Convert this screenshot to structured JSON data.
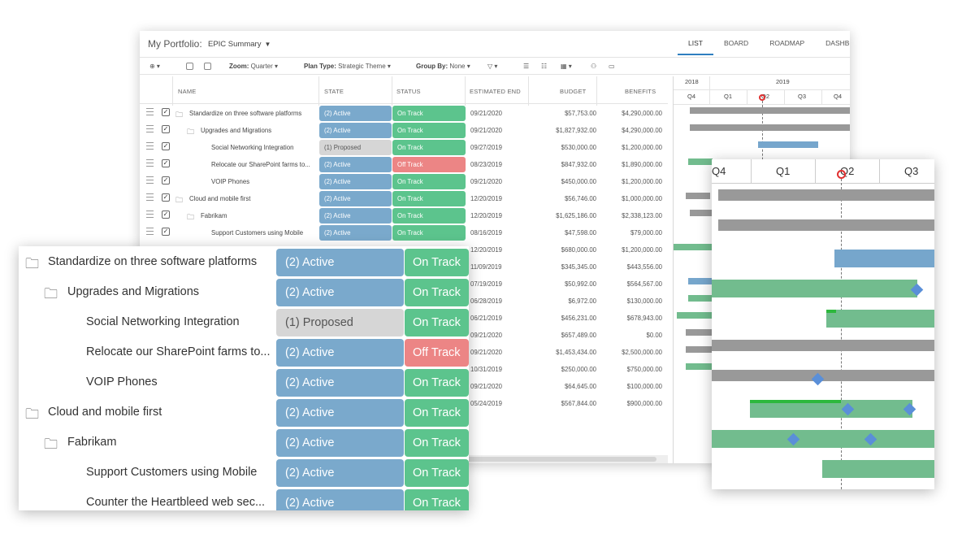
{
  "window": {
    "title": "My Portfolio:",
    "view_name": "EPIC Summary",
    "view_tabs": [
      "LIST",
      "BOARD",
      "ROADMAP",
      "DASHBO"
    ]
  },
  "toolbar": {
    "zoom_label": "Zoom:",
    "zoom_value": "Quarter",
    "plan_type_label": "Plan Type:",
    "plan_type_value": "Strategic Theme",
    "group_by_label": "Group By:",
    "group_by_value": "None"
  },
  "columns": {
    "name": "NAME",
    "state": "STATE",
    "status": "STATUS",
    "estimated_end": "ESTIMATED END",
    "budget": "BUDGET",
    "benefits": "BENEFITS"
  },
  "rows": [
    {
      "name": "Standardize on three software platforms",
      "state": "(2) Active",
      "status": "On Track",
      "end": "09/21/2020",
      "budget": "$57,753.00",
      "benefits": "$4,290,000.00"
    },
    {
      "name": "Upgrades and Migrations",
      "state": "(2) Active",
      "status": "On Track",
      "end": "09/21/2020",
      "budget": "$1,827,932.00",
      "benefits": "$4,290,000.00"
    },
    {
      "name": "Social Networking Integration",
      "state": "(1) Proposed",
      "status": "On Track",
      "end": "09/27/2019",
      "budget": "$530,000.00",
      "benefits": "$1,200,000.00"
    },
    {
      "name": "Relocate our SharePoint farms to...",
      "state": "(2) Active",
      "status": "Off Track",
      "end": "08/23/2019",
      "budget": "$847,932.00",
      "benefits": "$1,890,000.00"
    },
    {
      "name": "VOIP Phones",
      "state": "(2) Active",
      "status": "On Track",
      "end": "09/21/2020",
      "budget": "$450,000.00",
      "benefits": "$1,200,000.00"
    },
    {
      "name": "Cloud and mobile first",
      "state": "(2) Active",
      "status": "On Track",
      "end": "12/20/2019",
      "budget": "$56,746.00",
      "benefits": "$1,000,000.00"
    },
    {
      "name": "Fabrikam",
      "state": "(2) Active",
      "status": "On Track",
      "end": "12/20/2019",
      "budget": "$1,625,186.00",
      "benefits": "$2,338,123.00"
    },
    {
      "name": "Support Customers using Mobile",
      "state": "(2) Active",
      "status": "On Track",
      "end": "08/16/2019",
      "budget": "$47,598.00",
      "benefits": "$79,000.00"
    },
    {
      "name": "Counter the Heartbleed web sec...",
      "state": "(2) Active",
      "status": "On Track",
      "end": "12/20/2019",
      "budget": "$680,000.00",
      "benefits": "$1,200,000.00"
    }
  ],
  "more_rows": [
    {
      "end": "11/09/2019",
      "budget": "$345,345.00",
      "benefits": "$443,556.00"
    },
    {
      "end": "07/19/2019",
      "budget": "$50,992.00",
      "benefits": "$564,567.00"
    },
    {
      "end": "06/28/2019",
      "budget": "$6,972.00",
      "benefits": "$130,000.00"
    },
    {
      "end": "06/21/2019",
      "budget": "$456,231.00",
      "benefits": "$678,943.00"
    },
    {
      "end": "09/21/2020",
      "budget": "$657,489.00",
      "benefits": "$0.00"
    },
    {
      "end": "09/21/2020",
      "budget": "$1,453,434.00",
      "benefits": "$2,500,000.00"
    },
    {
      "end": "10/31/2019",
      "budget": "$250,000.00",
      "benefits": "$750,000.00"
    },
    {
      "end": "09/21/2020",
      "budget": "$64,645.00",
      "benefits": "$100,000.00"
    },
    {
      "end": "05/24/2019",
      "budget": "$567,844.00",
      "benefits": "$900,000.00"
    }
  ],
  "gantt": {
    "years": [
      "2018",
      "2019"
    ],
    "quarters": [
      "Q4",
      "Q1",
      "Q2",
      "Q3",
      "Q4"
    ],
    "zoom_quarters": [
      "Q4",
      "Q1",
      "Q2",
      "Q3"
    ]
  },
  "colors": {
    "active": "#7aa9cc",
    "proposed": "#d6d6d6",
    "on_track": "#5cc48d",
    "off_track": "#ec8585",
    "gantt_gray": "#999999",
    "gantt_blue": "#76a6cc",
    "gantt_green": "#72bc8e",
    "milestone": "#5a8fd8"
  }
}
